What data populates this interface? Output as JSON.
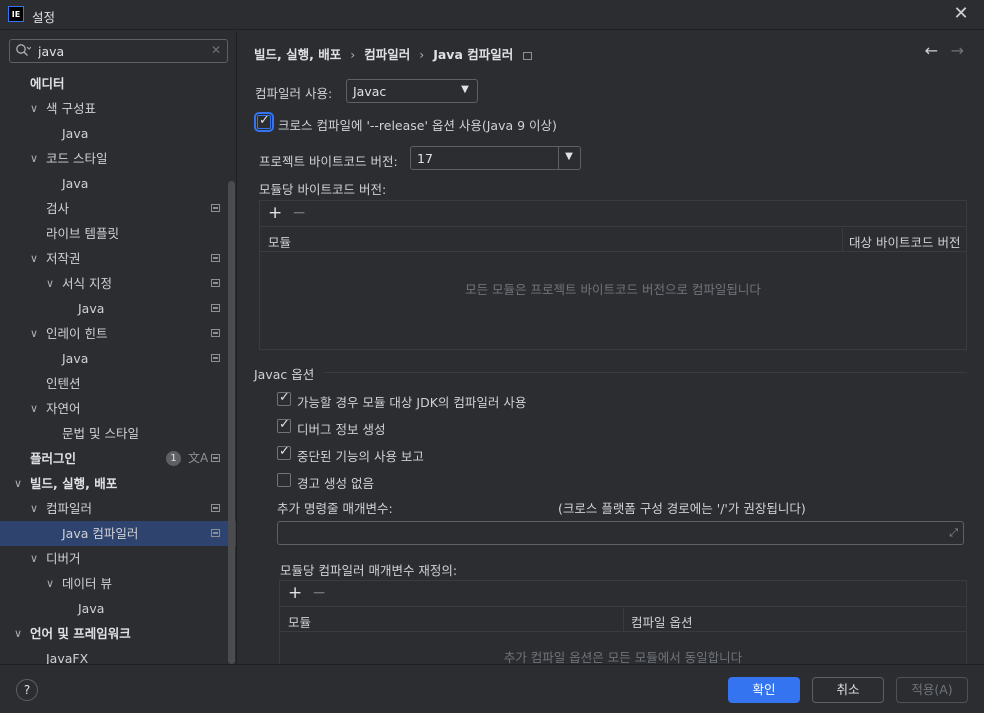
{
  "window": {
    "logo": "IE",
    "title": "설정",
    "close_icon": "✕"
  },
  "search": {
    "value": "java",
    "clear_icon": "✕"
  },
  "sidebar": {
    "items": [
      {
        "label": "에디터",
        "bold": true
      },
      {
        "label": "색 구성표",
        "chevron": "∨"
      },
      {
        "label": "Java"
      },
      {
        "label": "코드 스타일",
        "chevron": "∨"
      },
      {
        "label": "Java"
      },
      {
        "label": "검사",
        "project": true
      },
      {
        "label": "라이브 템플릿"
      },
      {
        "label": "저작권",
        "chevron": "∨",
        "project": true
      },
      {
        "label": "서식 지정",
        "chevron": "∨",
        "project": true
      },
      {
        "label": "Java",
        "project": true
      },
      {
        "label": "인레이 힌트",
        "chevron": "∨",
        "project": true
      },
      {
        "label": "Java",
        "project": true
      },
      {
        "label": "인텐션"
      },
      {
        "label": "자연어",
        "chevron": "∨"
      },
      {
        "label": "문법 및 스타일"
      },
      {
        "label": "플러그인",
        "bold": true,
        "badge": "1",
        "project": true
      },
      {
        "label": "빌드, 실행, 배포",
        "bold": true,
        "chevron": "∨"
      },
      {
        "label": "컴파일러",
        "chevron": "∨",
        "project": true
      },
      {
        "label": "Java 컴파일러",
        "selected": true,
        "project": true
      },
      {
        "label": "디버거",
        "chevron": "∨"
      },
      {
        "label": "데이터 뷰",
        "chevron": "∨"
      },
      {
        "label": "Java"
      },
      {
        "label": "언어 및 프레임워크",
        "bold": true,
        "chevron": "∨"
      },
      {
        "label": "JavaFX"
      }
    ]
  },
  "breadcrumb": {
    "items": [
      "빌드, 실행, 배포",
      "컴파일러",
      "Java 컴파일러"
    ],
    "separator": "›"
  },
  "nav": {
    "back_icon": "←",
    "forward_icon": "→"
  },
  "compiler": {
    "label": "컴파일러 사용:",
    "value": "Javac",
    "cross_compile_label": "크로스 컴파일에 '--release' 옵션 사용(Java 9 이상)",
    "cross_compile_checked": true,
    "bytecode_label": "프로젝트 바이트코드 버전:",
    "bytecode_value": "17",
    "per_module_label": "모듈당 바이트코드 버전:"
  },
  "module_table": {
    "add_icon": "+",
    "remove_icon": "−",
    "col_module": "모듈",
    "col_target": "대상 바이트코드 버전",
    "empty_text": "모든 모듈은 프로젝트 바이트코드 버전으로 컴파일됩니다"
  },
  "javac": {
    "section_title": "Javac 옵션",
    "options": [
      {
        "label": "가능할 경우 모듈 대상 JDK의 컴파일러 사용",
        "checked": true
      },
      {
        "label": "디버그 정보 생성",
        "checked": true
      },
      {
        "label": "중단된 기능의 사용 보고",
        "checked": true
      },
      {
        "label": "경고 생성 없음",
        "checked": false
      }
    ],
    "params_label": "추가 명령줄 매개변수:",
    "params_hint": "(크로스 플랫폼 구성 경로에는 '/'가 권장됩니다)",
    "params_value": "",
    "expand_icon": "⤢",
    "override_label": "모듈당 컴파일러 매개변수 재정의:"
  },
  "override_table": {
    "add_icon": "+",
    "remove_icon": "−",
    "col_module": "모듈",
    "col_options": "컴파일 옵션",
    "empty_text": "추가 컴파일 옵션은 모든 모듈에서 동일합니다"
  },
  "footer": {
    "help": "?",
    "ok": "확인",
    "cancel": "취소",
    "apply": "적용(A)"
  },
  "colors": {
    "accent": "#3574f0",
    "selection": "#2e436e",
    "background": "#2b2d30"
  }
}
